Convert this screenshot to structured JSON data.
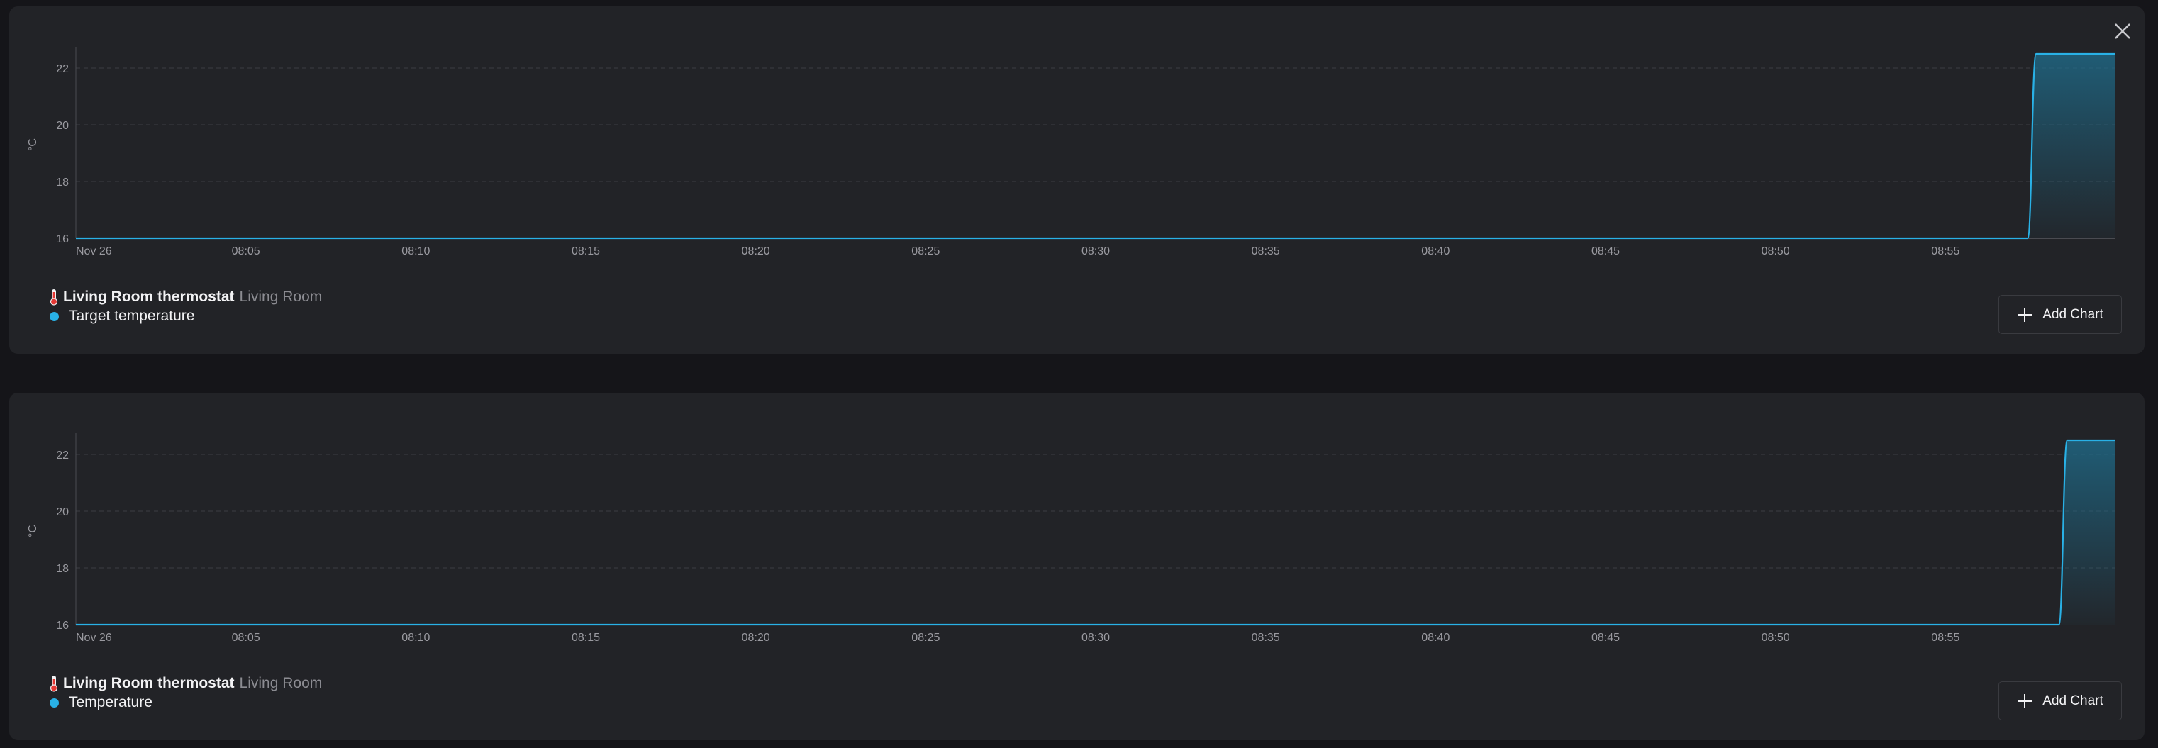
{
  "colors": {
    "background": "#151519",
    "card": "#222327",
    "series": "#29b1e6",
    "grid": "#3c3d43",
    "text": "#f2f2f4",
    "muted": "#8c8c92"
  },
  "close_icon": "close-icon",
  "charts": [
    {
      "device": {
        "name": "Living Room thermostat",
        "room": "Living Room",
        "icon": "thermometer-icon"
      },
      "series_label": "Target temperature",
      "add_chart_label": "Add Chart",
      "add_icon": "plus-icon"
    },
    {
      "device": {
        "name": "Living Room thermostat",
        "room": "Living Room",
        "icon": "thermometer-icon"
      },
      "series_label": "Temperature",
      "add_chart_label": "Add Chart",
      "add_icon": "plus-icon"
    }
  ],
  "chart_data": [
    {
      "type": "area",
      "ylabel": "°C",
      "ylim": [
        16,
        22.6
      ],
      "yticks": [
        16,
        18,
        20,
        22
      ],
      "xlim": [
        "08:00",
        "09:00"
      ],
      "xticks": [
        "Nov 26",
        "08:05",
        "08:10",
        "08:15",
        "08:20",
        "08:25",
        "08:30",
        "08:35",
        "08:40",
        "08:45",
        "08:50",
        "08:55"
      ],
      "grid": true,
      "series": [
        {
          "name": "Target temperature",
          "x": [
            "08:00",
            "08:57:25",
            "08:57:40",
            "09:00"
          ],
          "values": [
            16,
            16,
            22.5,
            22.5
          ]
        }
      ]
    },
    {
      "type": "area",
      "ylabel": "°C",
      "ylim": [
        16,
        22.6
      ],
      "yticks": [
        16,
        18,
        20,
        22
      ],
      "xlim": [
        "08:00",
        "09:00"
      ],
      "xticks": [
        "Nov 26",
        "08:05",
        "08:10",
        "08:15",
        "08:20",
        "08:25",
        "08:30",
        "08:35",
        "08:40",
        "08:45",
        "08:50",
        "08:55"
      ],
      "grid": true,
      "series": [
        {
          "name": "Temperature",
          "x": [
            "08:00",
            "08:58:20",
            "08:58:35",
            "09:00"
          ],
          "values": [
            16,
            16,
            22.5,
            22.5
          ]
        }
      ]
    }
  ]
}
